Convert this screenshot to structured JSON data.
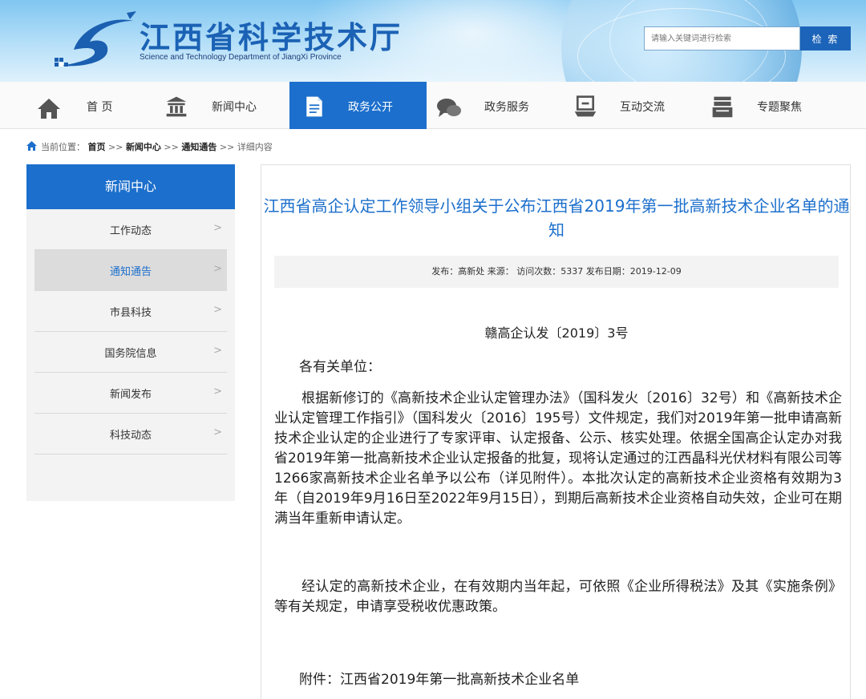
{
  "header": {
    "site_title": "江西省科学技术厅",
    "site_subtitle": "Science and Technology Department of JiangXi Province",
    "search": {
      "placeholder": "请输入关键词进行检索",
      "button_label": "检 索"
    },
    "brand_color": "#1c6fcc"
  },
  "nav": {
    "items": [
      {
        "label": "首 页",
        "icon": "home-icon"
      },
      {
        "label": "新闻中心",
        "icon": "building-icon"
      },
      {
        "label": "政务公开",
        "icon": "document-icon",
        "active": true
      },
      {
        "label": "政务服务",
        "icon": "chat-icon"
      },
      {
        "label": "互动交流",
        "icon": "monitor-icon"
      },
      {
        "label": "专题聚焦",
        "icon": "folder-icon"
      }
    ]
  },
  "breadcrumb": {
    "prefix": "当前位置：",
    "home": "首页",
    "sep": " >> ",
    "section": "新闻中心",
    "subsection": "通知通告",
    "current": "详细内容"
  },
  "sidebar": {
    "header": "新闻中心",
    "items": [
      {
        "label": "工作动态"
      },
      {
        "label": "通知通告",
        "active": true
      },
      {
        "label": "市县科技"
      },
      {
        "label": "国务院信息"
      },
      {
        "label": "新闻发布"
      },
      {
        "label": "科技动态"
      }
    ],
    "chevron": ">"
  },
  "article": {
    "title": "江西省高企认定工作领导小组关于公布江西省2019年第一批高新技术企业名单的通知",
    "meta": "发布：高新处  来源：  访问次数：5337  发布日期：2019-12-09",
    "doc_number": "赣高企认发〔2019〕3号",
    "salutation": "各有关单位：",
    "paragraph1": "根据新修订的《高新技术企业认定管理办法》（国科发火〔2016〕32号）和《高新技术企业认定管理工作指引》（国科发火〔2016〕195号）文件规定，我们对2019年第一批申请高新技术企业认定的企业进行了专家评审、认定报备、公示、核实处理。依据全国高企认定办对我省2019年第一批高新技术企业认定报备的批复，现将认定通过的江西晶科光伏材料有限公司等1266家高新技术企业名单予以公布（详见附件）。本批次认定的高新技术企业资格有效期为3年（自2019年9月16日至2022年9月15日），到期后高新技术企业资格自动失效，企业可在期满当年重新申请认定。",
    "paragraph2": "经认定的高新技术企业，在有效期内当年起，可依照《企业所得税法》及其《实施条例》等有关规定，申请享受税收优惠政策。",
    "attachment": "附件：江西省2019年第一批高新技术企业名单"
  }
}
